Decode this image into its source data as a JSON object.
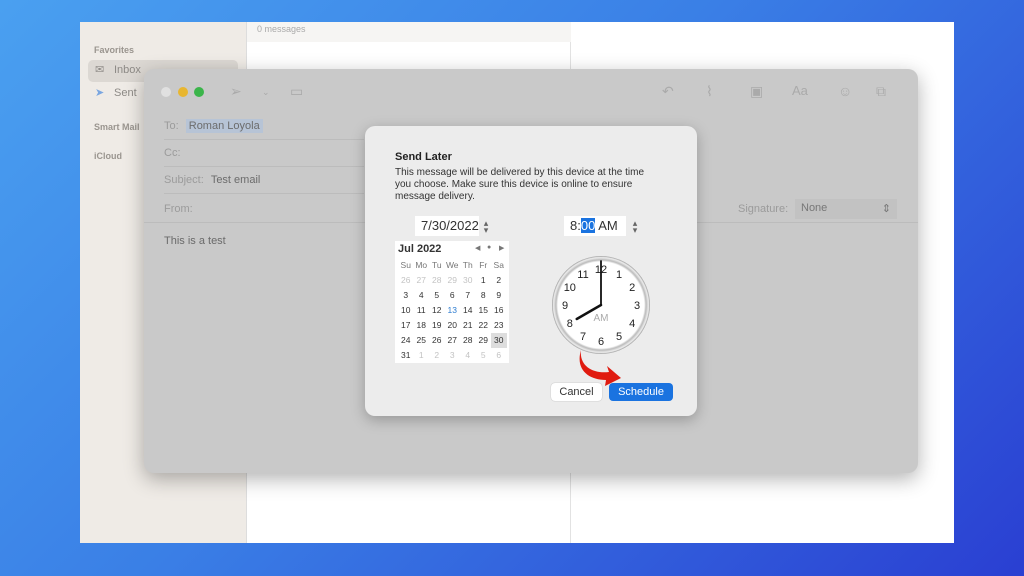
{
  "sidebar": {
    "favorites_label": "Favorites",
    "items": [
      {
        "label": "Inbox",
        "icon": "inbox-icon"
      },
      {
        "label": "Sent",
        "icon": "paper-plane-icon"
      }
    ],
    "smart_mailboxes_label": "Smart Mail",
    "icloud_label": "iCloud"
  },
  "message_list": {
    "count_label": "0 messages"
  },
  "compose": {
    "to_label": "To:",
    "to_value": "Roman Loyola",
    "cc_label": "Cc:",
    "subject_label": "Subject:",
    "subject_value": "Test email",
    "from_label": "From:",
    "signature_label": "Signature:",
    "signature_value": "None",
    "body": "This is a test",
    "font_button": "Aa"
  },
  "send_later": {
    "title": "Send Later",
    "description": "This message will be delivered by this device at the time you choose. Make sure this device is online to ensure message delivery.",
    "date_value": "7/30/2022",
    "time_hour": "8:",
    "time_minute": "00",
    "time_ampm": "AM",
    "calendar": {
      "month_label": "Jul 2022",
      "weekdays": [
        "Su",
        "Mo",
        "Tu",
        "We",
        "Th",
        "Fr",
        "Sa"
      ],
      "weeks": [
        [
          "26",
          "27",
          "28",
          "29",
          "30",
          "1",
          "2"
        ],
        [
          "3",
          "4",
          "5",
          "6",
          "7",
          "8",
          "9"
        ],
        [
          "10",
          "11",
          "12",
          "13",
          "14",
          "15",
          "16"
        ],
        [
          "17",
          "18",
          "19",
          "20",
          "21",
          "22",
          "23"
        ],
        [
          "24",
          "25",
          "26",
          "27",
          "28",
          "29",
          "30"
        ],
        [
          "31",
          "1",
          "2",
          "3",
          "4",
          "5",
          "6"
        ]
      ],
      "today": "13",
      "selected": "30"
    },
    "clock": {
      "numbers": [
        "12",
        "1",
        "2",
        "3",
        "4",
        "5",
        "6",
        "7",
        "8",
        "9",
        "10",
        "11"
      ],
      "ampm": "AM",
      "hour": 8,
      "minute": 0
    },
    "cancel_label": "Cancel",
    "schedule_label": "Schedule",
    "accent_color": "#1a73e0"
  }
}
